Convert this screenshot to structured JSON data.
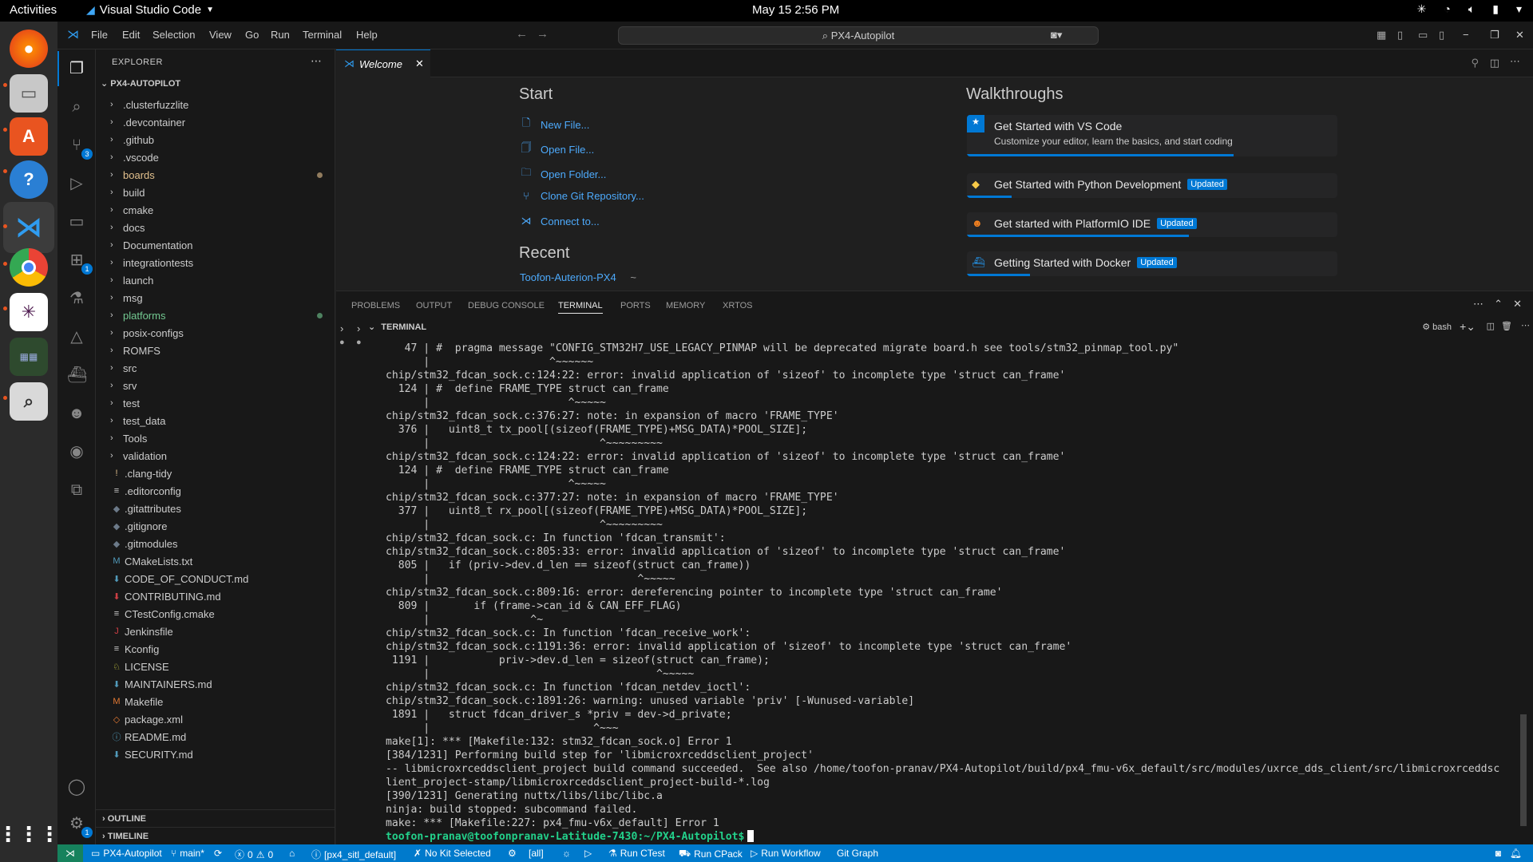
{
  "system": {
    "activities": "Activities",
    "app_menu": "Visual Studio Code",
    "clock": "May 15  2:56 PM"
  },
  "titlebar": {
    "menu": [
      "File",
      "Edit",
      "Selection",
      "View",
      "Go",
      "Run",
      "Terminal",
      "Help"
    ],
    "command_center": "PX4-Autopilot"
  },
  "activity_badges": {
    "source_control": "3",
    "extensions": "1",
    "accounts_settings": "1"
  },
  "sidebar": {
    "title": "EXPLORER",
    "root": "PX4-AUTOPILOT",
    "items": [
      {
        "label": ".clusterfuzzlite",
        "type": "folder"
      },
      {
        "label": ".devcontainer",
        "type": "folder"
      },
      {
        "label": ".github",
        "type": "folder"
      },
      {
        "label": ".vscode",
        "type": "folder"
      },
      {
        "label": "boards",
        "type": "folder",
        "modified": true,
        "color": "#e2c08d"
      },
      {
        "label": "build",
        "type": "folder"
      },
      {
        "label": "cmake",
        "type": "folder"
      },
      {
        "label": "docs",
        "type": "folder"
      },
      {
        "label": "Documentation",
        "type": "folder"
      },
      {
        "label": "integrationtests",
        "type": "folder"
      },
      {
        "label": "launch",
        "type": "folder"
      },
      {
        "label": "msg",
        "type": "folder"
      },
      {
        "label": "platforms",
        "type": "folder",
        "modified": true,
        "color": "#73c991"
      },
      {
        "label": "posix-configs",
        "type": "folder"
      },
      {
        "label": "ROMFS",
        "type": "folder"
      },
      {
        "label": "src",
        "type": "folder"
      },
      {
        "label": "srv",
        "type": "folder"
      },
      {
        "label": "test",
        "type": "folder"
      },
      {
        "label": "test_data",
        "type": "folder"
      },
      {
        "label": "Tools",
        "type": "folder"
      },
      {
        "label": "validation",
        "type": "folder"
      },
      {
        "label": ".clang-tidy",
        "type": "file",
        "icon": "!",
        "icolor": "#e2c08d"
      },
      {
        "label": ".editorconfig",
        "type": "file",
        "icon": "≡",
        "icolor": "#cccccc"
      },
      {
        "label": ".gitattributes",
        "type": "file",
        "icon": "◆",
        "icolor": "#6c7a89"
      },
      {
        "label": ".gitignore",
        "type": "file",
        "icon": "◆",
        "icolor": "#6c7a89"
      },
      {
        "label": ".gitmodules",
        "type": "file",
        "icon": "◆",
        "icolor": "#6c7a89"
      },
      {
        "label": "CMakeLists.txt",
        "type": "file",
        "icon": "M",
        "icolor": "#519aba"
      },
      {
        "label": "CODE_OF_CONDUCT.md",
        "type": "file",
        "icon": "⬇",
        "icolor": "#519aba"
      },
      {
        "label": "CONTRIBUTING.md",
        "type": "file",
        "icon": "⬇",
        "icolor": "#cc3e44"
      },
      {
        "label": "CTestConfig.cmake",
        "type": "file",
        "icon": "≡",
        "icolor": "#cccccc"
      },
      {
        "label": "Jenkinsfile",
        "type": "file",
        "icon": "J",
        "icolor": "#cc3e44"
      },
      {
        "label": "Kconfig",
        "type": "file",
        "icon": "≡",
        "icolor": "#cccccc"
      },
      {
        "label": "LICENSE",
        "type": "file",
        "icon": "♘",
        "icolor": "#cbcb41"
      },
      {
        "label": "MAINTAINERS.md",
        "type": "file",
        "icon": "⬇",
        "icolor": "#519aba"
      },
      {
        "label": "Makefile",
        "type": "file",
        "icon": "M",
        "icolor": "#e37933"
      },
      {
        "label": "package.xml",
        "type": "file",
        "icon": "◇",
        "icolor": "#e37933"
      },
      {
        "label": "README.md",
        "type": "file",
        "icon": "ⓘ",
        "icolor": "#519aba"
      },
      {
        "label": "SECURITY.md",
        "type": "file",
        "icon": "⬇",
        "icolor": "#519aba"
      }
    ],
    "outline": "OUTLINE",
    "timeline": "TIMELINE"
  },
  "editor": {
    "tab_label": "Welcome",
    "start_heading": "Start",
    "start_links": [
      {
        "label": "New File...",
        "icon": "new-file-icon"
      },
      {
        "label": "Open File...",
        "icon": "open-file-icon"
      },
      {
        "label": "Open Folder...",
        "icon": "open-folder-icon"
      },
      {
        "label": "Clone Git Repository...",
        "icon": "git-clone-icon"
      },
      {
        "label": "Connect to...",
        "icon": "remote-connect-icon"
      }
    ],
    "recent_heading": "Recent",
    "recent_item": "Toofon-Auterion-PX4",
    "recent_path": "~",
    "walkthroughs_heading": "Walkthroughs",
    "walkthroughs": [
      {
        "title": "Get Started with VS Code",
        "desc": "Customize your editor, learn the basics, and start coding",
        "badge": "",
        "progress": 0.72
      },
      {
        "title": "Get Started with Python Development",
        "desc": "",
        "badge": "Updated",
        "progress": 0.12
      },
      {
        "title": "Get started with PlatformIO IDE",
        "desc": "",
        "badge": "Updated",
        "progress": 0.6
      },
      {
        "title": "Getting Started with Docker",
        "desc": "",
        "badge": "Updated",
        "progress": 0.17
      }
    ]
  },
  "panel": {
    "tabs": [
      "PROBLEMS",
      "OUTPUT",
      "DEBUG CONSOLE",
      "TERMINAL",
      "PORTS",
      "MEMORY",
      "XRTOS"
    ],
    "active_tab": "TERMINAL",
    "terminal_header": "TERMINAL",
    "shell": "bash",
    "lines": [
      "   47 | #  pragma message \"CONFIG_STM32H7_USE_LEGACY_PINMAP will be deprecated migrate board.h see tools/stm32_pinmap_tool.py\"",
      "      |                   ^~~~~~~",
      "chip/stm32_fdcan_sock.c:124:22: error: invalid application of 'sizeof' to incomplete type 'struct can_frame'",
      "  124 | #  define FRAME_TYPE struct can_frame",
      "      |                      ^~~~~~",
      "chip/stm32_fdcan_sock.c:376:27: note: in expansion of macro 'FRAME_TYPE'",
      "  376 |   uint8_t tx_pool[(sizeof(FRAME_TYPE)+MSG_DATA)*POOL_SIZE];",
      "      |                           ^~~~~~~~~~",
      "chip/stm32_fdcan_sock.c:124:22: error: invalid application of 'sizeof' to incomplete type 'struct can_frame'",
      "  124 | #  define FRAME_TYPE struct can_frame",
      "      |                      ^~~~~~",
      "chip/stm32_fdcan_sock.c:377:27: note: in expansion of macro 'FRAME_TYPE'",
      "  377 |   uint8_t rx_pool[(sizeof(FRAME_TYPE)+MSG_DATA)*POOL_SIZE];",
      "      |                           ^~~~~~~~~~",
      "chip/stm32_fdcan_sock.c: In function 'fdcan_transmit':",
      "chip/stm32_fdcan_sock.c:805:33: error: invalid application of 'sizeof' to incomplete type 'struct can_frame'",
      "  805 |   if (priv->dev.d_len == sizeof(struct can_frame))",
      "      |                                 ^~~~~~",
      "chip/stm32_fdcan_sock.c:809:16: error: dereferencing pointer to incomplete type 'struct can_frame'",
      "  809 |       if (frame->can_id & CAN_EFF_FLAG)",
      "      |                ^~",
      "chip/stm32_fdcan_sock.c: In function 'fdcan_receive_work':",
      "chip/stm32_fdcan_sock.c:1191:36: error: invalid application of 'sizeof' to incomplete type 'struct can_frame'",
      " 1191 |           priv->dev.d_len = sizeof(struct can_frame);",
      "      |                                    ^~~~~~",
      "chip/stm32_fdcan_sock.c: In function 'fdcan_netdev_ioctl':",
      "chip/stm32_fdcan_sock.c:1891:26: warning: unused variable 'priv' [-Wunused-variable]",
      " 1891 |   struct fdcan_driver_s *priv = dev->d_private;",
      "      |                          ^~~~",
      "make[1]: *** [Makefile:132: stm32_fdcan_sock.o] Error 1",
      "[384/1231] Performing build step for 'libmicroxrceddsclient_project'",
      "-- libmicroxrceddsclient_project build command succeeded.  See also /home/toofon-pranav/PX4-Autopilot/build/px4_fmu-v6x_default/src/modules/uxrce_dds_client/src/libmicroxrceddsc",
      "lient_project-stamp/libmicroxrceddsclient_project-build-*.log",
      "[390/1231] Generating nuttx/libs/libc/libc.a",
      "ninja: build stopped: subcommand failed.",
      "make: *** [Makefile:227: px4_fmu-v6x_default] Error 1"
    ],
    "prompt": "toofon-pranav@toofonpranav-Latitude-7430:~/PX4-Autopilot$"
  },
  "statusbar": {
    "project": "PX4-Autopilot",
    "branch": "main*",
    "problems_errors": "0",
    "problems_warnings": "0",
    "config": "[px4_sitl_default]",
    "kit": "No Kit Selected",
    "target": "[all]",
    "run_ctest": "Run CTest",
    "run_cpack": "Run CPack",
    "run_workflow": "Run Workflow",
    "git_graph": "Git Graph"
  },
  "colors": {
    "accent": "#0078d4",
    "statusbar": "#007acc",
    "prompt": "#23d18b",
    "link": "#4daafc"
  }
}
